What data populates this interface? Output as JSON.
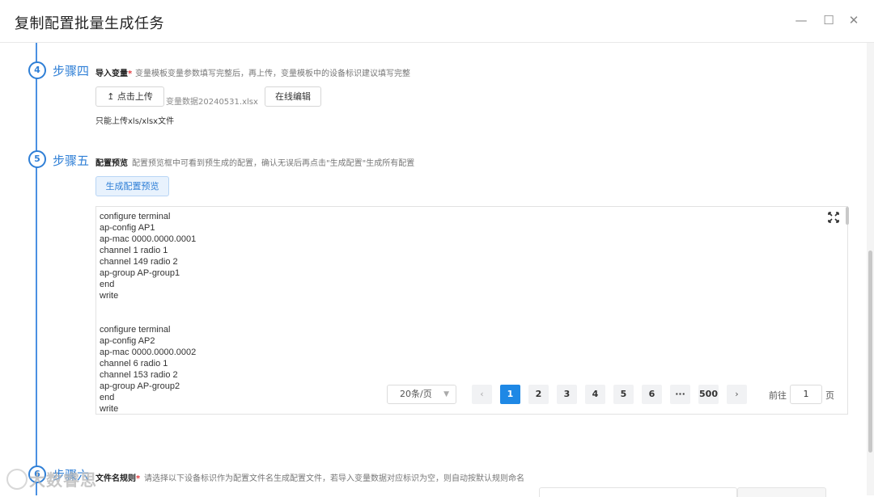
{
  "window": {
    "title": "复制配置批量生成任务",
    "controls": {
      "minimize": "—",
      "maximize": "☐",
      "close": "✕"
    }
  },
  "steps": [
    {
      "number": "4",
      "label": "步骤四",
      "field_label": "导入变量",
      "required_mark": "*",
      "description": "变量模板变量参数填写完整后，再上传，变量模板中的设备标识建议填写完整",
      "upload_button": "↥ 点击上传",
      "filename": "变量数据20240531.xlsx",
      "edit_button": "在线编辑",
      "hint": "只能上传xls/xlsx文件"
    },
    {
      "number": "5",
      "label": "步骤五",
      "field_label": "配置预览",
      "description": "配置预览框中可看到预生成的配置，确认无误后再点击\"生成配置\"生成所有配置",
      "generate_button": "生成配置预览",
      "preview_text": "configure terminal\nap-config AP1\nap-mac 0000.0000.0001\nchannel 1 radio 1\nchannel 149 radio 2\nap-group AP-group1\nend\nwrite\n\n\nconfigure terminal\nap-config AP2\nap-mac 0000.0000.0002\nchannel 6 radio 1\nchannel 153 radio 2\nap-group AP-group2\nend\nwrite"
    },
    {
      "number": "6",
      "label": "步骤六",
      "field_label": "文件名规则",
      "required_mark": "*",
      "description": "请选择以下设备标识作为配置文件名生成配置文件，若导入变量数据对应标识为空，则自动按默认规则命名"
    }
  ],
  "pagination": {
    "page_size": "20条/页",
    "prev": "‹",
    "pages": [
      "1",
      "2",
      "3",
      "4",
      "5",
      "6"
    ],
    "ellipsis": "···",
    "last": "500",
    "next": "›",
    "active_page": "1",
    "goto_prefix": "前往",
    "goto_value": "1",
    "goto_suffix": "页"
  },
  "icons": {
    "expand": "expand-icon",
    "upload": "upload-icon"
  },
  "watermark": "大数睿思",
  "colors": {
    "accent": "#2f7fd6",
    "active_page": "#1e88e5",
    "required": "#e4393c"
  }
}
